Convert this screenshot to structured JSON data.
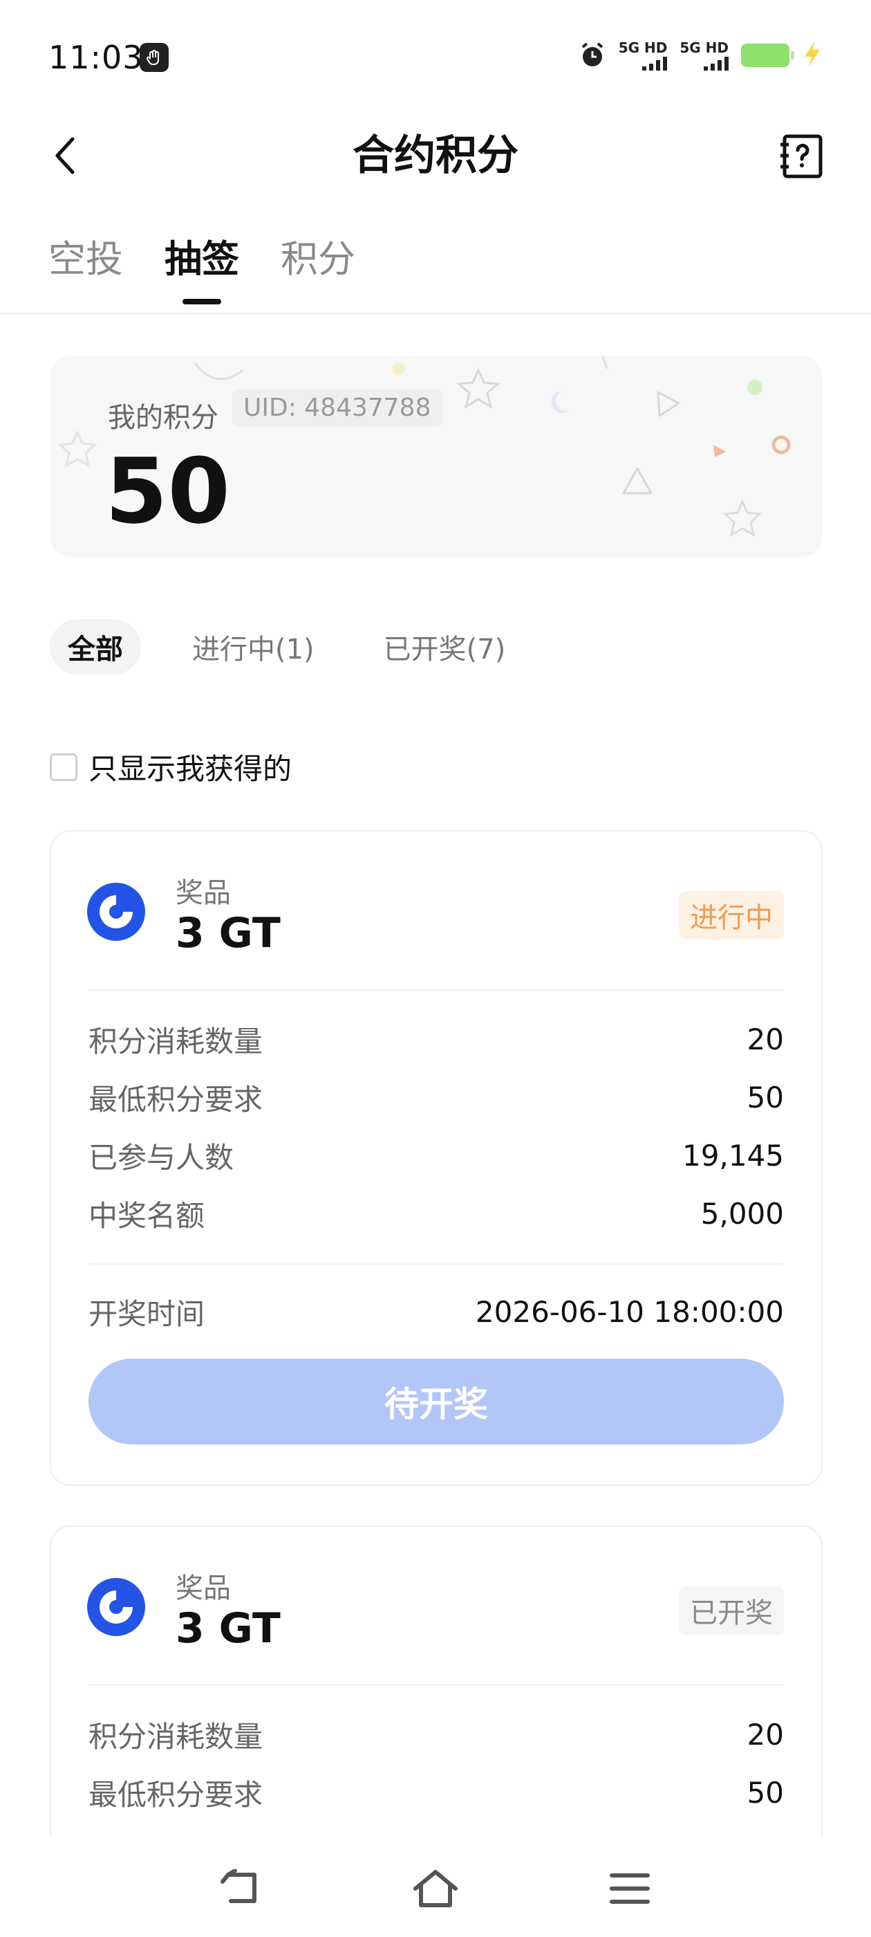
{
  "status_bar": {
    "time": "11:03",
    "network1": "5G HD",
    "network2": "5G HD"
  },
  "header": {
    "title": "合约积分"
  },
  "tabs": [
    {
      "label": "空投",
      "active": false
    },
    {
      "label": "抽签",
      "active": true
    },
    {
      "label": "积分",
      "active": false
    }
  ],
  "points": {
    "label": "我的积分",
    "uid": "UID: 48437788",
    "value": "50"
  },
  "filters": [
    {
      "label": "全部",
      "active": true
    },
    {
      "label": "进行中(1)",
      "active": false
    },
    {
      "label": "已开奖(7)",
      "active": false
    }
  ],
  "only_mine": {
    "label": "只显示我获得的",
    "checked": false
  },
  "cards": [
    {
      "prize_label": "奖品",
      "prize": "3 GT",
      "status": "进行中",
      "rows": [
        {
          "label": "积分消耗数量",
          "value": "20"
        },
        {
          "label": "最低积分要求",
          "value": "50"
        },
        {
          "label": "已参与人数",
          "value": "19,145"
        },
        {
          "label": "中奖名额",
          "value": "5,000"
        }
      ],
      "draw_time_label": "开奖时间",
      "draw_time": "2026-06-10 18:00:00",
      "button": "待开奖"
    },
    {
      "prize_label": "奖品",
      "prize": "3 GT",
      "status": "已开奖",
      "rows": [
        {
          "label": "积分消耗数量",
          "value": "20"
        },
        {
          "label": "最低积分要求",
          "value": "50"
        }
      ]
    }
  ],
  "colors": {
    "brand_blue": "#2354e6",
    "ongoing_orange": "#ef9b54",
    "button_disabled": "#b3c6f8"
  }
}
